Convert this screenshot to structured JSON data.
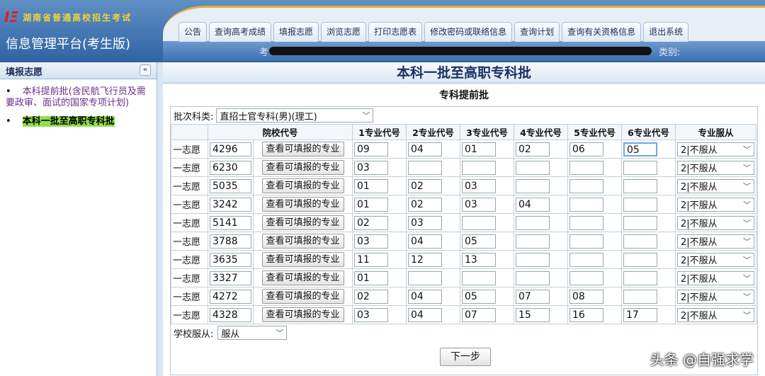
{
  "header": {
    "logo_text": "湖南省普通高校招生考试",
    "platform": "信息管理平台(考生版)",
    "info_left": "考",
    "info_right": "类别:"
  },
  "tabs": [
    "公告",
    "查询高考成绩",
    "填报志愿",
    "浏览志愿",
    "打印志愿表",
    "修改密码或联络信息",
    "查询计划",
    "查询有关资格信息",
    "退出系统"
  ],
  "sidebar": {
    "title": "填报志愿",
    "collapse": "«",
    "items": [
      {
        "label": "本科提前批(含民航飞行员及需要政审、面试的国家专项计划)",
        "active": false
      },
      {
        "label": "本科一批至高职专科批",
        "active": true
      }
    ]
  },
  "main": {
    "title": "本科一批至高职专科批",
    "subtitle": "专科提前批",
    "batch_label": "批次科类:",
    "batch_value": "直招士官专科(男)(理工)",
    "headers": [
      "院校代号",
      "1专业代号",
      "2专业代号",
      "3专业代号",
      "4专业代号",
      "5专业代号",
      "6专业代号",
      "专业服从"
    ],
    "view_button": "查看可填报的专业",
    "rows": [
      {
        "label": "一志愿",
        "school": "4296",
        "majors": [
          "09",
          "04",
          "01",
          "02",
          "06",
          "05"
        ],
        "obey": "2|不服从"
      },
      {
        "label": "一志愿",
        "school": "6230",
        "majors": [
          "03",
          "",
          "",
          "",
          "",
          ""
        ],
        "obey": "2|不服从"
      },
      {
        "label": "一志愿",
        "school": "5035",
        "majors": [
          "01",
          "02",
          "03",
          "",
          "",
          ""
        ],
        "obey": "2|不服从"
      },
      {
        "label": "一志愿",
        "school": "3242",
        "majors": [
          "01",
          "02",
          "03",
          "04",
          "",
          ""
        ],
        "obey": "2|不服从"
      },
      {
        "label": "一志愿",
        "school": "5141",
        "majors": [
          "02",
          "03",
          "",
          "",
          "",
          ""
        ],
        "obey": "2|不服从"
      },
      {
        "label": "一志愿",
        "school": "3788",
        "majors": [
          "03",
          "04",
          "05",
          "",
          "",
          ""
        ],
        "obey": "2|不服从"
      },
      {
        "label": "一志愿",
        "school": "3635",
        "majors": [
          "11",
          "12",
          "13",
          "",
          "",
          ""
        ],
        "obey": "2|不服从"
      },
      {
        "label": "一志愿",
        "school": "3327",
        "majors": [
          "01",
          "",
          "",
          "",
          "",
          ""
        ],
        "obey": "2|不服从"
      },
      {
        "label": "一志愿",
        "school": "4272",
        "majors": [
          "02",
          "04",
          "05",
          "07",
          "08",
          ""
        ],
        "obey": "2|不服从"
      },
      {
        "label": "一志愿",
        "school": "4328",
        "majors": [
          "03",
          "04",
          "07",
          "15",
          "16",
          "17"
        ],
        "obey": "2|不服从"
      }
    ],
    "school_obey_label": "学校服从:",
    "school_obey_value": "服从",
    "next_button": "下一步"
  },
  "watermark": "头条 @自强求学"
}
